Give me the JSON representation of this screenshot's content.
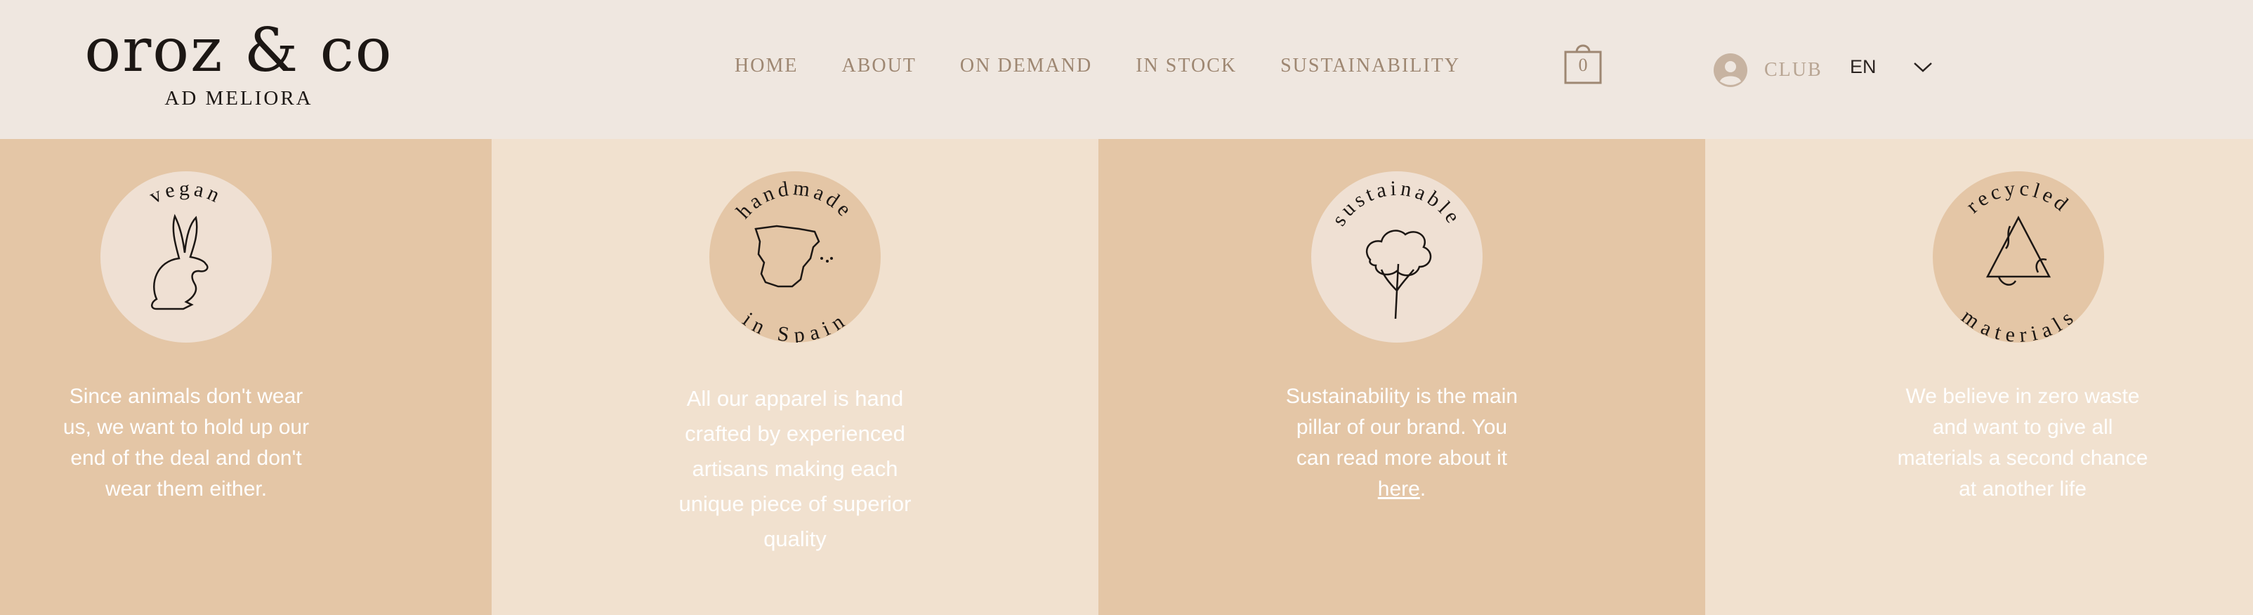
{
  "brand": {
    "name": "oroz & co",
    "tagline": "AD MELIORA"
  },
  "nav": {
    "items": [
      "HOME",
      "ABOUT",
      "ON DEMAND",
      "IN STOCK",
      "SUSTAINABILITY"
    ]
  },
  "cart": {
    "count": "0"
  },
  "club": {
    "label": "CLUB"
  },
  "language": {
    "current": "EN"
  },
  "colors": {
    "header_bg": "#efe7e0",
    "panel_dark": "#e4c6a6",
    "panel_light": "#f1e1cf",
    "nav_text": "#9e8772",
    "ink": "#1c1714"
  },
  "features": [
    {
      "badge_top": "vegan",
      "badge_bottom": "",
      "icon": "rabbit-icon",
      "text_lines": [
        "Since animals don't wear",
        "us, we want to hold up our",
        "end of the deal and don't",
        "wear them either."
      ]
    },
    {
      "badge_top": "handmade",
      "badge_bottom": "in Spain",
      "icon": "spain-map-icon",
      "text_lines": [
        "All our apparel is hand",
        "crafted by experienced",
        "artisans making each",
        "unique piece of superior",
        "quality"
      ]
    },
    {
      "badge_top": "sustainable",
      "badge_bottom": "",
      "icon": "tree-icon",
      "text_lines": [
        "Sustainability is the main",
        "pillar of our brand. You",
        "can read more about it"
      ],
      "link_text": "here",
      "link_suffix": "."
    },
    {
      "badge_top": "recycled",
      "badge_bottom": "materials",
      "icon": "recycle-icon",
      "text_lines": [
        "We believe in zero waste",
        "and want to give all",
        "materials a second chance",
        "at another life"
      ]
    }
  ]
}
